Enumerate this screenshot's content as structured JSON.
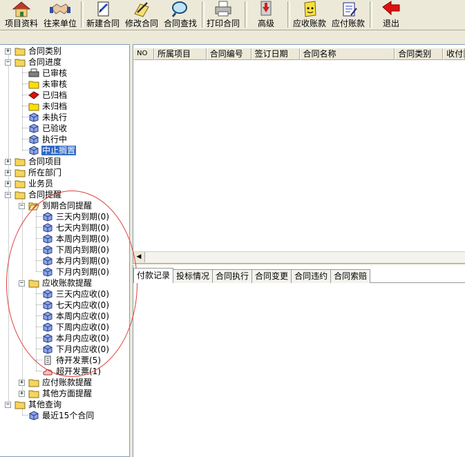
{
  "toolbar": {
    "project": "项目资料",
    "partner": "往来单位",
    "new_contract": "新建合同",
    "edit_contract": "修改合同",
    "find_contract": "合同查找",
    "print_contract": "打印合同",
    "advanced": "高级",
    "receivable": "应收账款",
    "payable": "应付账款",
    "exit": "退出"
  },
  "tree": {
    "category": "合同类别",
    "progress": "合同进度",
    "audited": "已审核",
    "unaudited": "未审核",
    "archived": "已归档",
    "unarchived": "未归档",
    "not_executed": "未执行",
    "accepted": "已验收",
    "executing": "执行中",
    "suspended": "中止搁置",
    "project": "合同项目",
    "department": "所在部门",
    "salesman": "业务员",
    "reminder": "合同提醒",
    "due_reminder": "到期合同提醒",
    "due_3days": "三天内到期(0)",
    "due_7days": "七天内到期(0)",
    "due_this_week": "本周内到期(0)",
    "due_next_week": "下周内到期(0)",
    "due_this_month": "本月内到期(0)",
    "due_next_month": "下月内到期(0)",
    "recv_reminder": "应收账款提醒",
    "recv_3days": "三天内应收(0)",
    "recv_7days": "七天内应收(0)",
    "recv_this_week": "本周内应收(0)",
    "recv_next_week": "下周内应收(0)",
    "recv_this_month": "本月内应收(0)",
    "recv_next_month": "下月内应收(0)",
    "invoice_pending": "待开发票(5)",
    "invoice_over": "超开发票(1)",
    "pay_reminder": "应付账款提醒",
    "other_reminder": "其他方面提醒",
    "other_query": "其他查询",
    "recent_15": "最近15个合同"
  },
  "list": {
    "columns": [
      "NO",
      "所属项目",
      "合同编号",
      "签订日期",
      "合同名称",
      "合同类别",
      "收付比"
    ]
  },
  "tabs": [
    "付款记录",
    "投标情况",
    "合同执行",
    "合同变更",
    "合同违约",
    "合同索赔"
  ],
  "colors": {
    "selection": "#316ac5",
    "folder": "#f5d55b",
    "annotation": "#e04040"
  }
}
